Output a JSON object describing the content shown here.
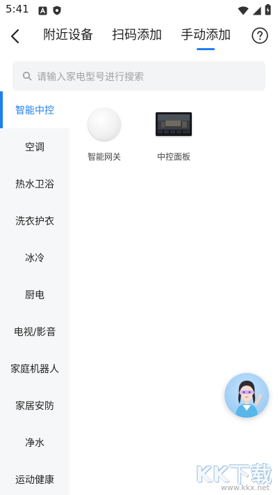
{
  "theme": {
    "accent": "#1f7ff2"
  },
  "status_bar": {
    "time": "5:41",
    "left_icons": [
      "notification-a-icon",
      "shield-icon"
    ],
    "right_icons": [
      "wifi-icon",
      "signal-icon",
      "battery-charging-icon"
    ]
  },
  "header": {
    "tabs": [
      {
        "label": "附近设备",
        "active": false
      },
      {
        "label": "扫码添加",
        "active": false
      },
      {
        "label": "手动添加",
        "active": true
      }
    ],
    "help_icon": "help-circle-icon",
    "back_icon": "chevron-left-icon"
  },
  "search": {
    "placeholder": "请输入家电型号进行搜索"
  },
  "categories": [
    {
      "label": "智能中控",
      "active": true
    },
    {
      "label": "空调"
    },
    {
      "label": "热水卫浴"
    },
    {
      "label": "洗衣护衣"
    },
    {
      "label": "冰冷"
    },
    {
      "label": "厨电"
    },
    {
      "label": "电视/影音"
    },
    {
      "label": "家庭机器人"
    },
    {
      "label": "家居安防"
    },
    {
      "label": "净水"
    },
    {
      "label": "运动健康"
    }
  ],
  "devices": [
    {
      "name": "智能网关",
      "icon": "gateway-image"
    },
    {
      "name": "中控面板",
      "icon": "control-panel-image"
    }
  ],
  "watermark": {
    "logo": "KK下载",
    "url": "www.kkx.net"
  }
}
